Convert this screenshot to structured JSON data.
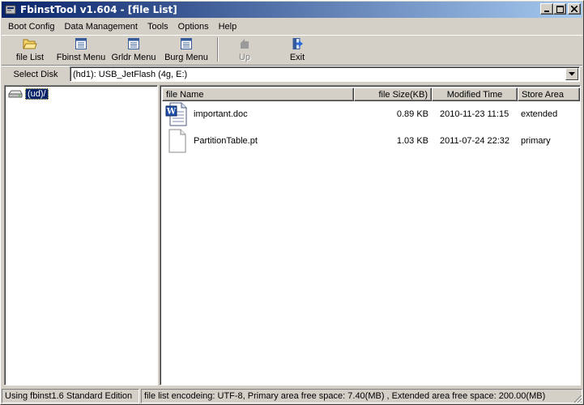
{
  "window": {
    "title": "FbinstTool v1.604 - [file List]",
    "controls": {
      "minimize": "_",
      "maximize": "□",
      "close": "×"
    }
  },
  "menu": [
    "Boot Config",
    "Data Management",
    "Tools",
    "Options",
    "Help"
  ],
  "toolbar": {
    "buttons": [
      {
        "label": "file List",
        "icon": "folder-open-icon",
        "enabled": true
      },
      {
        "label": "Fbinst Menu",
        "icon": "menu-document-icon",
        "enabled": true
      },
      {
        "label": "Grldr Menu",
        "icon": "menu-document-icon",
        "enabled": true
      },
      {
        "label": "Burg Menu",
        "icon": "menu-document-icon",
        "enabled": true
      },
      {
        "label": "Up",
        "icon": "up-arrow-icon",
        "enabled": false
      },
      {
        "label": "Exit",
        "icon": "exit-door-icon",
        "enabled": true
      }
    ]
  },
  "disk": {
    "label": "Select Disk",
    "selected": "(hd1): USB_JetFlash (4g, E:)"
  },
  "tree": {
    "root_label": "(ud)/"
  },
  "file_list": {
    "columns": [
      "file Name",
      "file Size(KB)",
      "Modified Time",
      "Store Area"
    ],
    "rows": [
      {
        "name": "important.doc",
        "size": "0.89 KB",
        "modified": "2010-11-23 11:15",
        "area": "extended",
        "icon": "word-document-icon"
      },
      {
        "name": "PartitionTable.pt",
        "size": "1.03 KB",
        "modified": "2011-07-24 22:32",
        "area": "primary",
        "icon": "blank-file-icon"
      }
    ]
  },
  "status": {
    "edition": "Using fbinst1.6 Standard Edition",
    "info": "file list encodeing: UTF-8, Primary area free space: 7.40(MB) ,  Extended area free space: 200.00(MB)"
  },
  "colors": {
    "titlebar_start": "#0a246a",
    "titlebar_end": "#a6caf0",
    "selection": "#0a246a",
    "face": "#d4d0c8"
  }
}
